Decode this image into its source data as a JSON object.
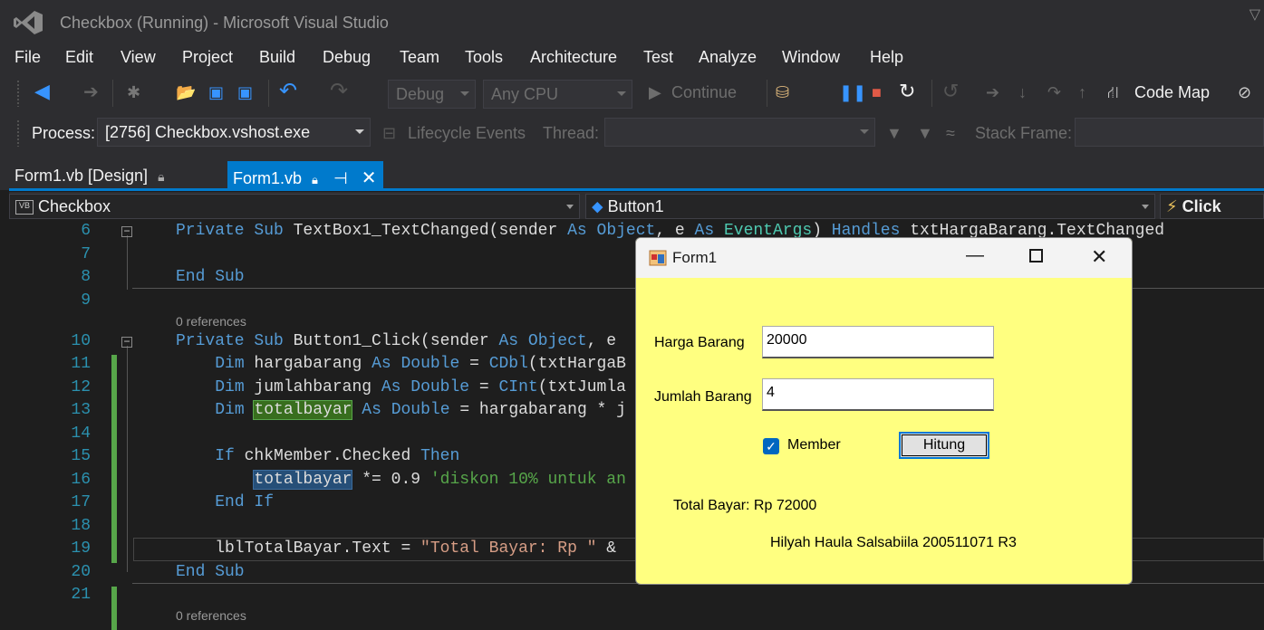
{
  "window": {
    "title": "Checkbox (Running) - Microsoft Visual Studio"
  },
  "menu": {
    "items": [
      "File",
      "Edit",
      "View",
      "Project",
      "Build",
      "Debug",
      "Team",
      "Tools",
      "Architecture",
      "Test",
      "Analyze",
      "Window",
      "Help"
    ]
  },
  "toolbar": {
    "config": "Debug",
    "platform": "Any CPU",
    "continue": "Continue",
    "code_map": "Code Map"
  },
  "debugbar": {
    "process_label": "Process:",
    "process_value": "[2756] Checkbox.vshost.exe",
    "lifecycle": "Lifecycle Events",
    "thread_label": "Thread:",
    "stack_label": "Stack Frame:"
  },
  "tabs": [
    {
      "label": "Form1.vb [Design]",
      "active": false
    },
    {
      "label": "Form1.vb",
      "active": true
    }
  ],
  "navbar": {
    "project": "Checkbox",
    "object": "Button1",
    "event": "Click"
  },
  "code": {
    "references_label": "0 references",
    "lines": [
      {
        "n": "6"
      },
      {
        "n": "7"
      },
      {
        "n": "8"
      },
      {
        "n": "9"
      },
      {
        "n": "10"
      },
      {
        "n": "11"
      },
      {
        "n": "12"
      },
      {
        "n": "13"
      },
      {
        "n": "14"
      },
      {
        "n": "15"
      },
      {
        "n": "16"
      },
      {
        "n": "17"
      },
      {
        "n": "18"
      },
      {
        "n": "19"
      },
      {
        "n": "20"
      },
      {
        "n": "21"
      }
    ]
  },
  "form": {
    "title": "Form1",
    "harga_label": "Harga Barang",
    "harga_value": "20000",
    "jumlah_label": "Jumlah Barang",
    "jumlah_value": "4",
    "member_label": "Member",
    "member_checked": true,
    "button_label": "Hitung",
    "total_label": "Total Bayar: Rp 72000",
    "author": "Hilyah Haula Salsabiila 200511071 R3"
  },
  "colors": {
    "accent": "#007acc",
    "form_bg": "#ffff80",
    "editor_bg": "#1e1e1e"
  }
}
